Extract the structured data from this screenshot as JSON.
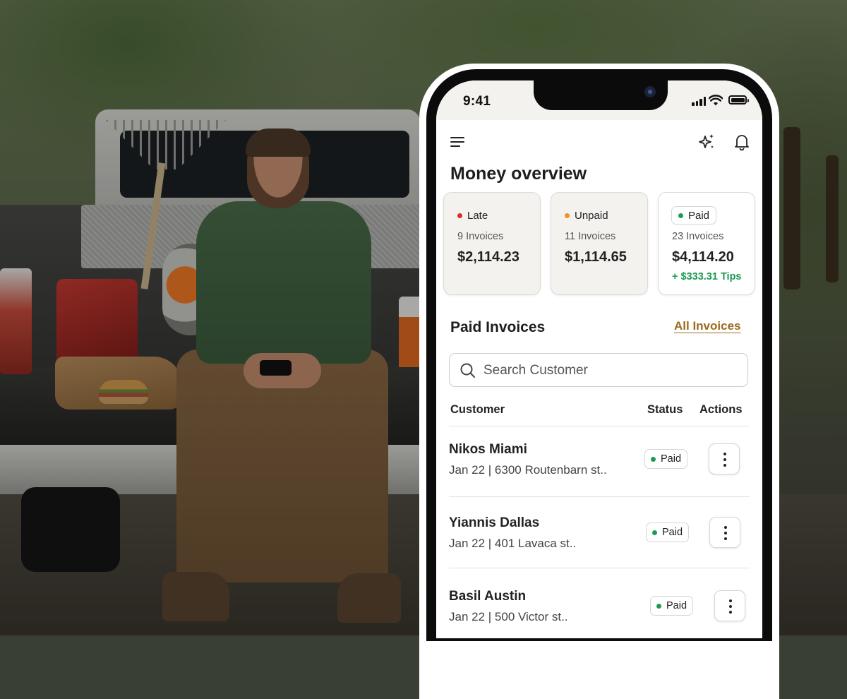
{
  "status_bar": {
    "time": "9:41"
  },
  "header": {
    "menu_icon": "hamburger-menu-icon",
    "sparkle_icon": "sparkle-icon",
    "bell_icon": "bell-icon"
  },
  "overview": {
    "title": "Money overview",
    "cards": [
      {
        "label": "Late",
        "count": "9 Invoices",
        "amount": "$2,114.23",
        "dot_color": "#e02a2a"
      },
      {
        "label": "Unpaid",
        "count": "11 Invoices",
        "amount": "$1,114.65",
        "dot_color": "#f0921e"
      },
      {
        "label": "Paid",
        "count": "23 Invoices",
        "amount": "$4,114.20",
        "tips": "+ $333.31 Tips",
        "dot_color": "#1e9a55"
      }
    ]
  },
  "paid_invoices": {
    "title": "Paid Invoices",
    "all_link": "All Invoices",
    "search_placeholder": "Search Customer",
    "columns": [
      "Customer",
      "Status",
      "Actions"
    ],
    "rows": [
      {
        "name": "Nikos Miami",
        "meta": "Jan 22 | 6300 Routenbarn st..",
        "status": "Paid"
      },
      {
        "name": "Yiannis Dallas",
        "meta": "Jan 22 | 401 Lavaca st..",
        "status": "Paid"
      },
      {
        "name": "Basil Austin",
        "meta": "Jan 22 | 500 Victor st..",
        "status": "Paid"
      }
    ]
  },
  "colors": {
    "accent_link": "#9a6c1c",
    "paid_green": "#1e9a55"
  }
}
